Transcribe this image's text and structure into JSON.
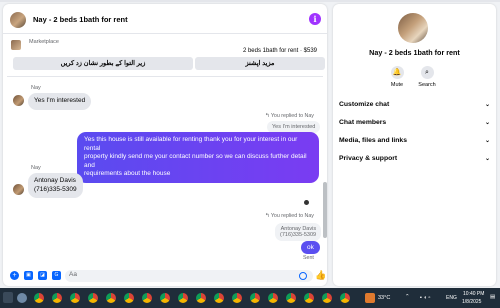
{
  "chat": {
    "title": "Nay - 2 beds 1bath for rent",
    "marketplace_label": "Marketplace",
    "listing_price": "2 beds 1bath for rent · $539",
    "btn_see_listing": "زیر التوا کے بطور نشان زد کریں",
    "btn_more": "مزید اپشنز",
    "messages": {
      "name1": "Nay",
      "msg1": "Yes I'm interested",
      "replied1": "You replied to Nay",
      "quote1": "Yes I'm interested",
      "out1_line1": "Yes this house is still available for renting thank you for your interest in our rental",
      "out1_line2": "property kindly send me your contact number so we can discuss further detail and",
      "out1_line3": "requirements about the house",
      "name2": "Nay",
      "msg2_line1": "Antonay Davis",
      "msg2_line2": "(716)335-5309",
      "replied2": "You replied to Nay",
      "quote2_line1": "Antonay Davis",
      "quote2_line2": "(716)335-5309",
      "out2": "ok",
      "seen": "Sent"
    },
    "composer": {
      "placeholder": "Aa"
    }
  },
  "panel": {
    "title": "Nay - 2 beds 1bath for rent",
    "mute": "Mute",
    "search": "Search",
    "rows": [
      "Customize chat",
      "Chat members",
      "Media, files and links",
      "Privacy & support"
    ]
  },
  "taskbar": {
    "temp": "33°C",
    "lang": "ENG",
    "time": "10:40 PM",
    "date": "1/8/2025"
  },
  "colors": {
    "accent": "#0866ff",
    "bubble_out": "#6b3ff5",
    "info": "#a033ff"
  }
}
